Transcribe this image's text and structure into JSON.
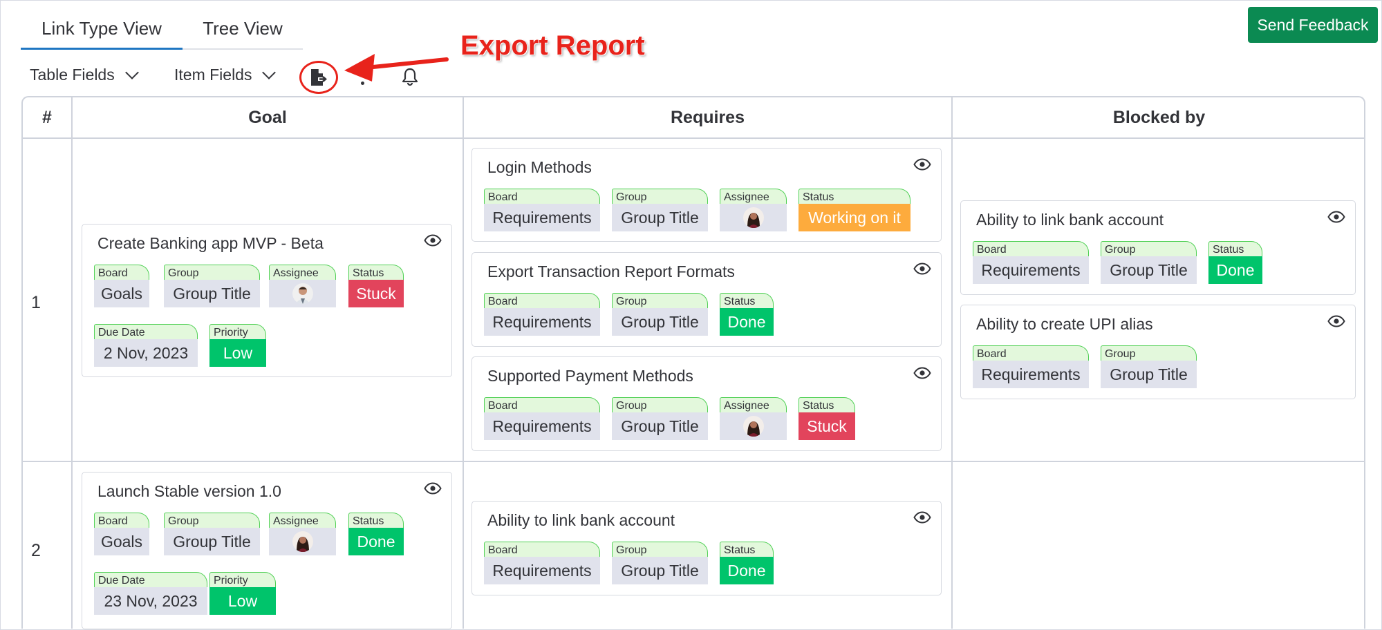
{
  "tabs": [
    {
      "label": "Link Type View",
      "active": true
    },
    {
      "label": "Tree View",
      "active": false
    }
  ],
  "send_feedback": "Send Feedback",
  "toolbar": {
    "table_fields": "Table Fields",
    "item_fields": "Item Fields",
    "export_icon": "export-file-icon",
    "bell_icon": "bell-icon"
  },
  "annotation": "Export Report",
  "columns": [
    "#",
    "Goal",
    "Requires",
    "Blocked by"
  ],
  "labels": {
    "board": "Board",
    "group": "Group",
    "assignee": "Assignee",
    "status": "Status",
    "due_date": "Due Date",
    "priority": "Priority"
  },
  "colors": {
    "done": "#00c46b",
    "stuck": "#e2445c",
    "working": "#fdab3d",
    "primary_button": "#0b8a52",
    "annotation": "#e8231b"
  },
  "rows": [
    {
      "num": "1",
      "goal": {
        "title": "Create Banking app MVP - Beta",
        "board": "Goals",
        "group": "Group Title",
        "status": "Stuck",
        "due_date": "2 Nov, 2023",
        "priority": "Low"
      },
      "requires": [
        {
          "title": "Login Methods",
          "board": "Requirements",
          "group": "Group Title",
          "status": "Working on it"
        },
        {
          "title": "Export Transaction Report Formats",
          "board": "Requirements",
          "group": "Group Title",
          "status": "Done"
        },
        {
          "title": "Supported Payment Methods",
          "board": "Requirements",
          "group": "Group Title",
          "status": "Stuck"
        }
      ],
      "blocked_by": [
        {
          "title": "Ability to link bank account",
          "board": "Requirements",
          "group": "Group Title",
          "status": "Done"
        },
        {
          "title": "Ability to create UPI alias",
          "board": "Requirements",
          "group": "Group Title"
        }
      ]
    },
    {
      "num": "2",
      "goal": {
        "title": "Launch Stable version 1.0",
        "board": "Goals",
        "group": "Group Title",
        "status": "Done",
        "due_date": "23 Nov, 2023",
        "priority": "Low"
      },
      "requires": [
        {
          "title": "Ability to link bank account",
          "board": "Requirements",
          "group": "Group Title",
          "status": "Done"
        }
      ],
      "blocked_by": []
    }
  ]
}
